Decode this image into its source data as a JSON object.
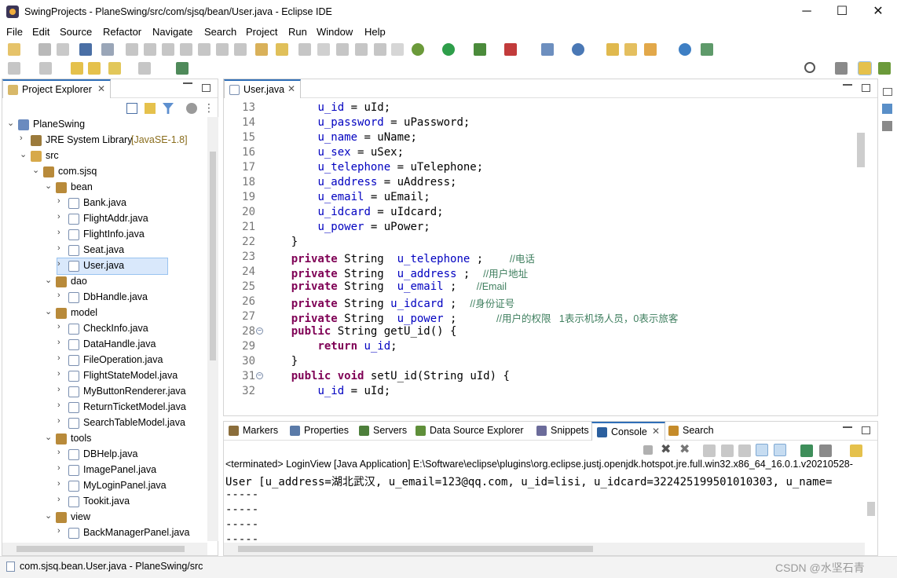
{
  "window": {
    "title": "SwingProjects - PlaneSwing/src/com/sjsq/bean/User.java - Eclipse IDE",
    "min": "─",
    "max": "☐",
    "close": "✕"
  },
  "menu": [
    "File",
    "Edit",
    "Source",
    "Refactor",
    "Navigate",
    "Search",
    "Project",
    "Run",
    "Window",
    "Help"
  ],
  "explorer": {
    "tab_label": "Project Explorer",
    "close": "✕",
    "tree": [
      {
        "label": "PlaneSwing",
        "level": 0,
        "arrow": "⌄",
        "kind": "project"
      },
      {
        "label": "JRE System Library",
        "decor": "[JavaSE-1.8]",
        "level": 1,
        "arrow": "›",
        "kind": "library"
      },
      {
        "label": "src",
        "level": 1,
        "arrow": "⌄",
        "kind": "srcfolder"
      },
      {
        "label": "com.sjsq",
        "level": 2,
        "arrow": "⌄",
        "kind": "package"
      },
      {
        "label": "bean",
        "level": 3,
        "arrow": "⌄",
        "kind": "package"
      },
      {
        "label": "Bank.java",
        "level": 4,
        "arrow": "›",
        "kind": "java"
      },
      {
        "label": "FlightAddr.java",
        "level": 4,
        "arrow": "›",
        "kind": "java"
      },
      {
        "label": "FlightInfo.java",
        "level": 4,
        "arrow": "›",
        "kind": "java"
      },
      {
        "label": "Seat.java",
        "level": 4,
        "arrow": "›",
        "kind": "java"
      },
      {
        "label": "User.java",
        "level": 4,
        "arrow": "›",
        "kind": "java",
        "selected": true
      },
      {
        "label": "dao",
        "level": 3,
        "arrow": "⌄",
        "kind": "package"
      },
      {
        "label": "DbHandle.java",
        "level": 4,
        "arrow": "›",
        "kind": "java"
      },
      {
        "label": "model",
        "level": 3,
        "arrow": "⌄",
        "kind": "package"
      },
      {
        "label": "CheckInfo.java",
        "level": 4,
        "arrow": "›",
        "kind": "java"
      },
      {
        "label": "DataHandle.java",
        "level": 4,
        "arrow": "›",
        "kind": "java"
      },
      {
        "label": "FileOperation.java",
        "level": 4,
        "arrow": "›",
        "kind": "java"
      },
      {
        "label": "FlightStateModel.java",
        "level": 4,
        "arrow": "›",
        "kind": "java"
      },
      {
        "label": "MyButtonRenderer.java",
        "level": 4,
        "arrow": "›",
        "kind": "java"
      },
      {
        "label": "ReturnTicketModel.java",
        "level": 4,
        "arrow": "›",
        "kind": "java"
      },
      {
        "label": "SearchTableModel.java",
        "level": 4,
        "arrow": "›",
        "kind": "java"
      },
      {
        "label": "tools",
        "level": 3,
        "arrow": "⌄",
        "kind": "package"
      },
      {
        "label": "DBHelp.java",
        "level": 4,
        "arrow": "›",
        "kind": "java"
      },
      {
        "label": "ImagePanel.java",
        "level": 4,
        "arrow": "›",
        "kind": "java"
      },
      {
        "label": "MyLoginPanel.java",
        "level": 4,
        "arrow": "›",
        "kind": "java"
      },
      {
        "label": "Tookit.java",
        "level": 4,
        "arrow": "›",
        "kind": "java"
      },
      {
        "label": "view",
        "level": 3,
        "arrow": "⌄",
        "kind": "package"
      },
      {
        "label": "BackManagerPanel.java",
        "level": 4,
        "arrow": "›",
        "kind": "java"
      }
    ]
  },
  "editor": {
    "tab_label": "User.java",
    "close": "✕",
    "lines": [
      {
        "n": "13",
        "parts": [
          {
            "t": "        "
          },
          {
            "t": "u_id",
            "c": "fld"
          },
          {
            "t": " = uId;"
          }
        ]
      },
      {
        "n": "14",
        "parts": [
          {
            "t": "        "
          },
          {
            "t": "u_password",
            "c": "fld"
          },
          {
            "t": " = uPassword;"
          }
        ]
      },
      {
        "n": "15",
        "parts": [
          {
            "t": "        "
          },
          {
            "t": "u_name",
            "c": "fld"
          },
          {
            "t": " = uName;"
          }
        ]
      },
      {
        "n": "16",
        "parts": [
          {
            "t": "        "
          },
          {
            "t": "u_sex",
            "c": "fld"
          },
          {
            "t": " = uSex;"
          }
        ]
      },
      {
        "n": "17",
        "parts": [
          {
            "t": "        "
          },
          {
            "t": "u_telephone",
            "c": "fld"
          },
          {
            "t": " = uTelephone;"
          }
        ]
      },
      {
        "n": "18",
        "parts": [
          {
            "t": "        "
          },
          {
            "t": "u_address",
            "c": "fld"
          },
          {
            "t": " = uAddress;"
          }
        ]
      },
      {
        "n": "19",
        "parts": [
          {
            "t": "        "
          },
          {
            "t": "u_email",
            "c": "fld"
          },
          {
            "t": " = uEmail;"
          }
        ]
      },
      {
        "n": "20",
        "parts": [
          {
            "t": "        "
          },
          {
            "t": "u_idcard",
            "c": "fld"
          },
          {
            "t": " = uIdcard;"
          }
        ]
      },
      {
        "n": "21",
        "parts": [
          {
            "t": "        "
          },
          {
            "t": "u_power",
            "c": "fld"
          },
          {
            "t": " = uPower;"
          }
        ]
      },
      {
        "n": "22",
        "parts": [
          {
            "t": "    }"
          }
        ]
      },
      {
        "n": "23",
        "parts": [
          {
            "t": "    "
          },
          {
            "t": "private",
            "c": "kw"
          },
          {
            "t": " String  "
          },
          {
            "t": "u_telephone",
            "c": "fld"
          },
          {
            "t": " ;    "
          },
          {
            "t": "//电话",
            "c": "cmt"
          }
        ]
      },
      {
        "n": "24",
        "parts": [
          {
            "t": "    "
          },
          {
            "t": "private",
            "c": "kw"
          },
          {
            "t": " String  "
          },
          {
            "t": "u_address",
            "c": "fld"
          },
          {
            "t": " ;  "
          },
          {
            "t": "//用户地址",
            "c": "cmt"
          }
        ]
      },
      {
        "n": "25",
        "parts": [
          {
            "t": "    "
          },
          {
            "t": "private",
            "c": "kw"
          },
          {
            "t": " String  "
          },
          {
            "t": "u_email",
            "c": "fld"
          },
          {
            "t": " ;   "
          },
          {
            "t": "//Email",
            "c": "cmt"
          }
        ]
      },
      {
        "n": "26",
        "parts": [
          {
            "t": "    "
          },
          {
            "t": "private",
            "c": "kw"
          },
          {
            "t": " String "
          },
          {
            "t": "u_idcard",
            "c": "fld"
          },
          {
            "t": " ;  "
          },
          {
            "t": "//身份证号",
            "c": "cmt"
          }
        ]
      },
      {
        "n": "27",
        "parts": [
          {
            "t": "    "
          },
          {
            "t": "private",
            "c": "kw"
          },
          {
            "t": " String  "
          },
          {
            "t": "u_power",
            "c": "fld"
          },
          {
            "t": " ;      "
          },
          {
            "t": "//用户的权限   1表示机场人员，0表示旅客",
            "c": "cmt"
          }
        ]
      },
      {
        "n": "28",
        "fold": true,
        "parts": [
          {
            "t": "    "
          },
          {
            "t": "public",
            "c": "kw"
          },
          {
            "t": " String getU_id() {"
          }
        ]
      },
      {
        "n": "29",
        "parts": [
          {
            "t": "        "
          },
          {
            "t": "return",
            "c": "kw"
          },
          {
            "t": " "
          },
          {
            "t": "u_id",
            "c": "fld"
          },
          {
            "t": ";"
          }
        ]
      },
      {
        "n": "30",
        "parts": [
          {
            "t": "    }"
          }
        ]
      },
      {
        "n": "31",
        "fold": true,
        "parts": [
          {
            "t": "    "
          },
          {
            "t": "public",
            "c": "kw"
          },
          {
            "t": " "
          },
          {
            "t": "void",
            "c": "kw"
          },
          {
            "t": " setU_id(String uId) {"
          }
        ]
      },
      {
        "n": "32",
        "parts": [
          {
            "t": "        "
          },
          {
            "t": "u_id",
            "c": "fld"
          },
          {
            "t": " = uId;"
          }
        ]
      }
    ]
  },
  "bottom": {
    "tabs": [
      {
        "label": "Markers",
        "color": "#8a6d3b"
      },
      {
        "label": "Properties",
        "color": "#5a7aa8"
      },
      {
        "label": "Servers",
        "color": "#4d7f3b"
      },
      {
        "label": "Data Source Explorer",
        "color": "#5f8f3a"
      },
      {
        "label": "Snippets",
        "color": "#6b6b9a"
      },
      {
        "label": "Console",
        "color": "#2b5f9e",
        "active": true
      },
      {
        "label": "Search",
        "color": "#c58b2a"
      }
    ],
    "console_header": "<terminated> LoginView [Java Application] E:\\Software\\eclipse\\plugins\\org.eclipse.justj.openjdk.hotspot.jre.full.win32.x86_64_16.0.1.v20210528-",
    "output": [
      "User [u_address=湖北武汉, u_email=123@qq.com, u_id=lisi, u_idcard=322425199501010303, u_name=",
      "-----",
      "-----",
      "-----",
      "-----"
    ]
  },
  "status": {
    "text": "com.sjsq.bean.User.java - PlaneSwing/src",
    "watermark": "CSDN @水坚石青"
  }
}
